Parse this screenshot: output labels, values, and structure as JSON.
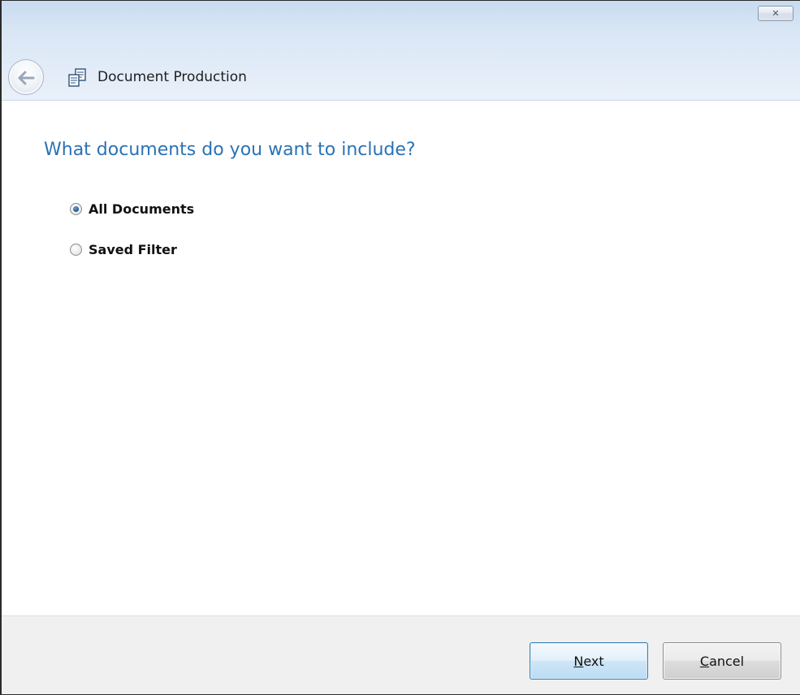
{
  "window": {
    "close_glyph": "✕"
  },
  "header": {
    "title": "Document Production"
  },
  "main": {
    "question": "What documents do you want to include?",
    "options": [
      {
        "label": "All Documents",
        "selected": true
      },
      {
        "label": "Saved Filter",
        "selected": false
      }
    ]
  },
  "footer": {
    "next": {
      "accel": "N",
      "rest": "ext"
    },
    "cancel": {
      "accel": "C",
      "rest": "ancel"
    }
  },
  "colors": {
    "heading": "#2a72b5",
    "titlebar": "#c8dbf0",
    "footer": "#f0f0f0"
  },
  "icons": {
    "back": "back-arrow-icon",
    "document": "document-production-icon",
    "close": "close-icon"
  }
}
